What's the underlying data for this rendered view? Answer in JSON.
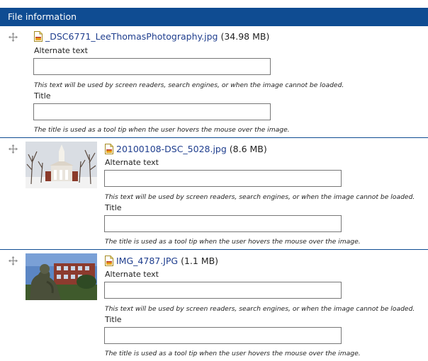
{
  "header": {
    "title": "File information"
  },
  "files": [
    {
      "name": "_DSC6771_LeeThomasPhotography.jpg",
      "size": "(34.98 MB)",
      "alt_label": "Alternate text",
      "alt_value": "",
      "alt_desc": "This text will be used by screen readers, search engines, or when the image cannot be loaded.",
      "title_label": "Title",
      "title_value": "",
      "title_desc": "The title is used as a tool tip when the user hovers the mouse over the image."
    },
    {
      "name": "20100108-DSC_5028.jpg",
      "size": "(8.6 MB)",
      "alt_label": "Alternate text",
      "alt_value": "",
      "alt_desc": "This text will be used by screen readers, search engines, or when the image cannot be loaded.",
      "title_label": "Title",
      "title_value": "",
      "title_desc": "The title is used as a tool tip when the user hovers the mouse over the image."
    },
    {
      "name": "IMG_4787.JPG",
      "size": "(1.1 MB)",
      "alt_label": "Alternate text",
      "alt_value": "",
      "alt_desc": "This text will be used by screen readers, search engines, or when the image cannot be loaded.",
      "title_label": "Title",
      "title_value": "",
      "title_desc": "The title is used as a tool tip when the user hovers the mouse over the image."
    }
  ],
  "icons": {
    "drag": "move-handle-icon",
    "file": "image-file-icon"
  },
  "colors": {
    "header_bg": "#0f4c92",
    "link": "#1f3e8e",
    "divider": "#0f4c92"
  }
}
